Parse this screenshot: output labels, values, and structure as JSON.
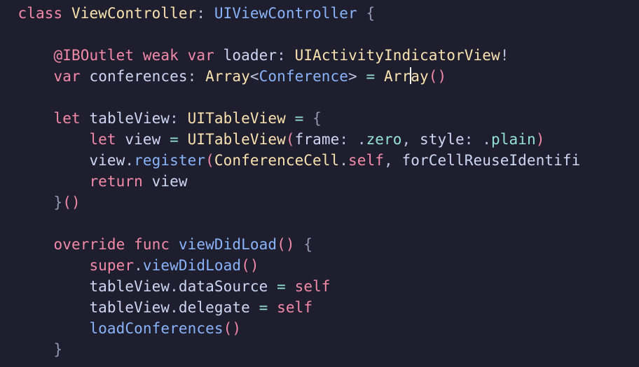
{
  "kw": {
    "class": "class",
    "weak": "weak",
    "var": "var",
    "let": "let",
    "override": "override",
    "func": "func",
    "return": "return",
    "super": "super",
    "self_lc": "self"
  },
  "attr": {
    "iboutlet": "@IBOutlet"
  },
  "types": {
    "ViewController": "ViewController",
    "UIViewController": "UIViewController",
    "UIActivityIndicatorView": "UIActivityIndicatorView",
    "Array": "Array",
    "Conference": "Conference",
    "UITableView": "UITableView",
    "ConferenceCell": "ConferenceCell"
  },
  "idents": {
    "loader": "loader",
    "conferences": "conferences",
    "tableView": "tableView",
    "view": "view",
    "frame": "frame",
    "style": "style",
    "register": "register",
    "forCellReuseIdentif": "forCellReuseIdentifi",
    "viewDidLoad": "viewDidLoad",
    "dataSource": "dataSource",
    "delegate": "delegate",
    "loadConferences": "loadConferences",
    "self_prop": "self"
  },
  "enums": {
    "zero": "zero",
    "plain": "plain"
  },
  "punct": {
    "colon": ":",
    "comma": ",",
    "dot": ".",
    "bang": "!",
    "lt": "<",
    "gt": ">",
    "eq": "=",
    "open_paren": "(",
    "close_paren": ")",
    "open_curly": "{",
    "close_curly": "}"
  },
  "cursor_after": "Arr",
  "array_split": {
    "left": "Arr",
    "right": "ay"
  }
}
